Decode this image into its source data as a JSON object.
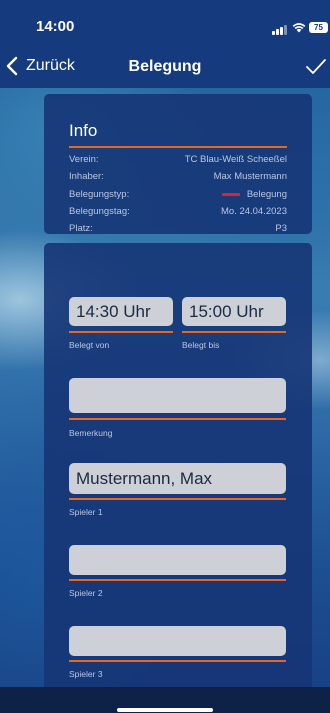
{
  "status_bar": {
    "time": "14:00",
    "battery": "75",
    "icons": [
      "signal-icon",
      "wifi-icon",
      "battery-icon"
    ]
  },
  "nav": {
    "back_label": "Zurück",
    "title": "Belegung",
    "back_icon": "chevron-left-icon",
    "confirm_icon": "checkmark-icon"
  },
  "info": {
    "title": "Info",
    "rows": [
      {
        "label": "Verein:",
        "value": "TC Blau-Weiß Scheeßel"
      },
      {
        "label": "Inhaber:",
        "value": "Max Mustermann"
      },
      {
        "label": "Belegungstyp:",
        "value": "Belegung"
      },
      {
        "label": "Belegungstag:",
        "value": "Mo. 24.04.2023"
      },
      {
        "label": "Platz:",
        "value": "P3"
      }
    ],
    "type_color": "#e0213a"
  },
  "form": {
    "from_value": "14:30 Uhr",
    "from_label": "Belegt von",
    "to_value": "15:00 Uhr",
    "to_label": "Belegt bis",
    "remark_value": "",
    "remark_label": "Bemerkung",
    "player1_value": "Mustermann, Max",
    "player1_label": "Spieler 1",
    "player2_value": "",
    "player2_label": "Spieler 2",
    "player3_value": "",
    "player3_label": "Spieler 3"
  },
  "colors": {
    "accent": "#e8671e",
    "nav_bar": "#163a7e",
    "card": "#163576",
    "field": "#cdd0d6"
  }
}
